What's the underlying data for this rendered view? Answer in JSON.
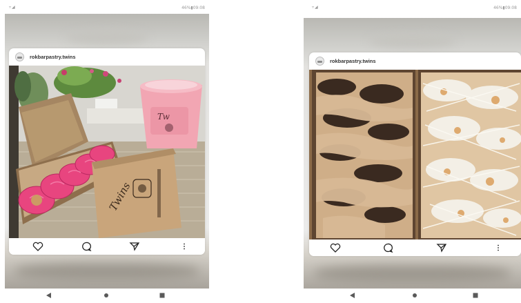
{
  "screens": [
    {
      "status": {
        "left": "▿◢",
        "right": "46%▮09:08"
      },
      "post": {
        "username": "rokbarpastry.twins",
        "box_print": "Twins"
      }
    },
    {
      "status": {
        "left": "▿◢",
        "right": "46%▮09:08"
      },
      "post": {
        "username": "rokbarpastry.twins"
      }
    }
  ],
  "icons": {
    "actions": [
      "heart-icon",
      "comment-icon",
      "send-icon",
      "more-vertical-icon"
    ],
    "nav": [
      "back-icon",
      "home-icon",
      "recents-icon"
    ]
  },
  "colors": {
    "pink_glaze": "#e8457f",
    "drink_pink": "#f2a6b3",
    "cardboard": "#a58662",
    "caramel_glaze": "#d8b995",
    "white_glaze": "#f3efe6"
  }
}
